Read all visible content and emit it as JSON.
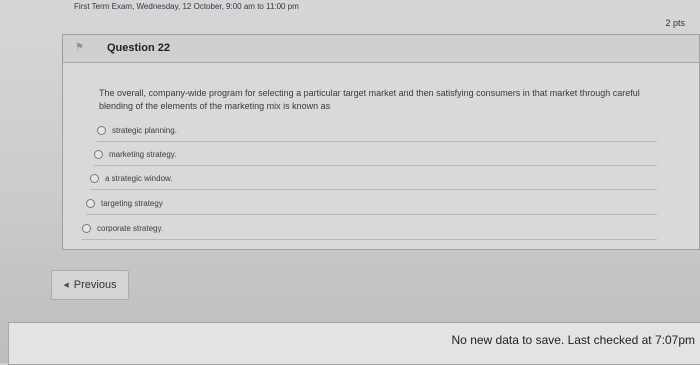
{
  "exam_header": "First Term Exam, Wednesday, 12 October, 9:00 am to 11:00 pm",
  "question": {
    "title": "Question 22",
    "points": "2 pts",
    "text": "The overall, company-wide program for selecting a particular target market and then satisfying consumers in that market through careful blending of the elements of the marketing mix is known as",
    "answers": [
      {
        "label": "strategic planning."
      },
      {
        "label": "marketing strategy."
      },
      {
        "label": "a strategic window."
      },
      {
        "label": "targeting strategy"
      },
      {
        "label": "corporate strategy."
      }
    ]
  },
  "nav": {
    "previous_label": "Previous",
    "previous_icon": "caret-left-icon"
  },
  "footer": {
    "save_status": "No new data to save. Last checked at 7:07pm"
  }
}
